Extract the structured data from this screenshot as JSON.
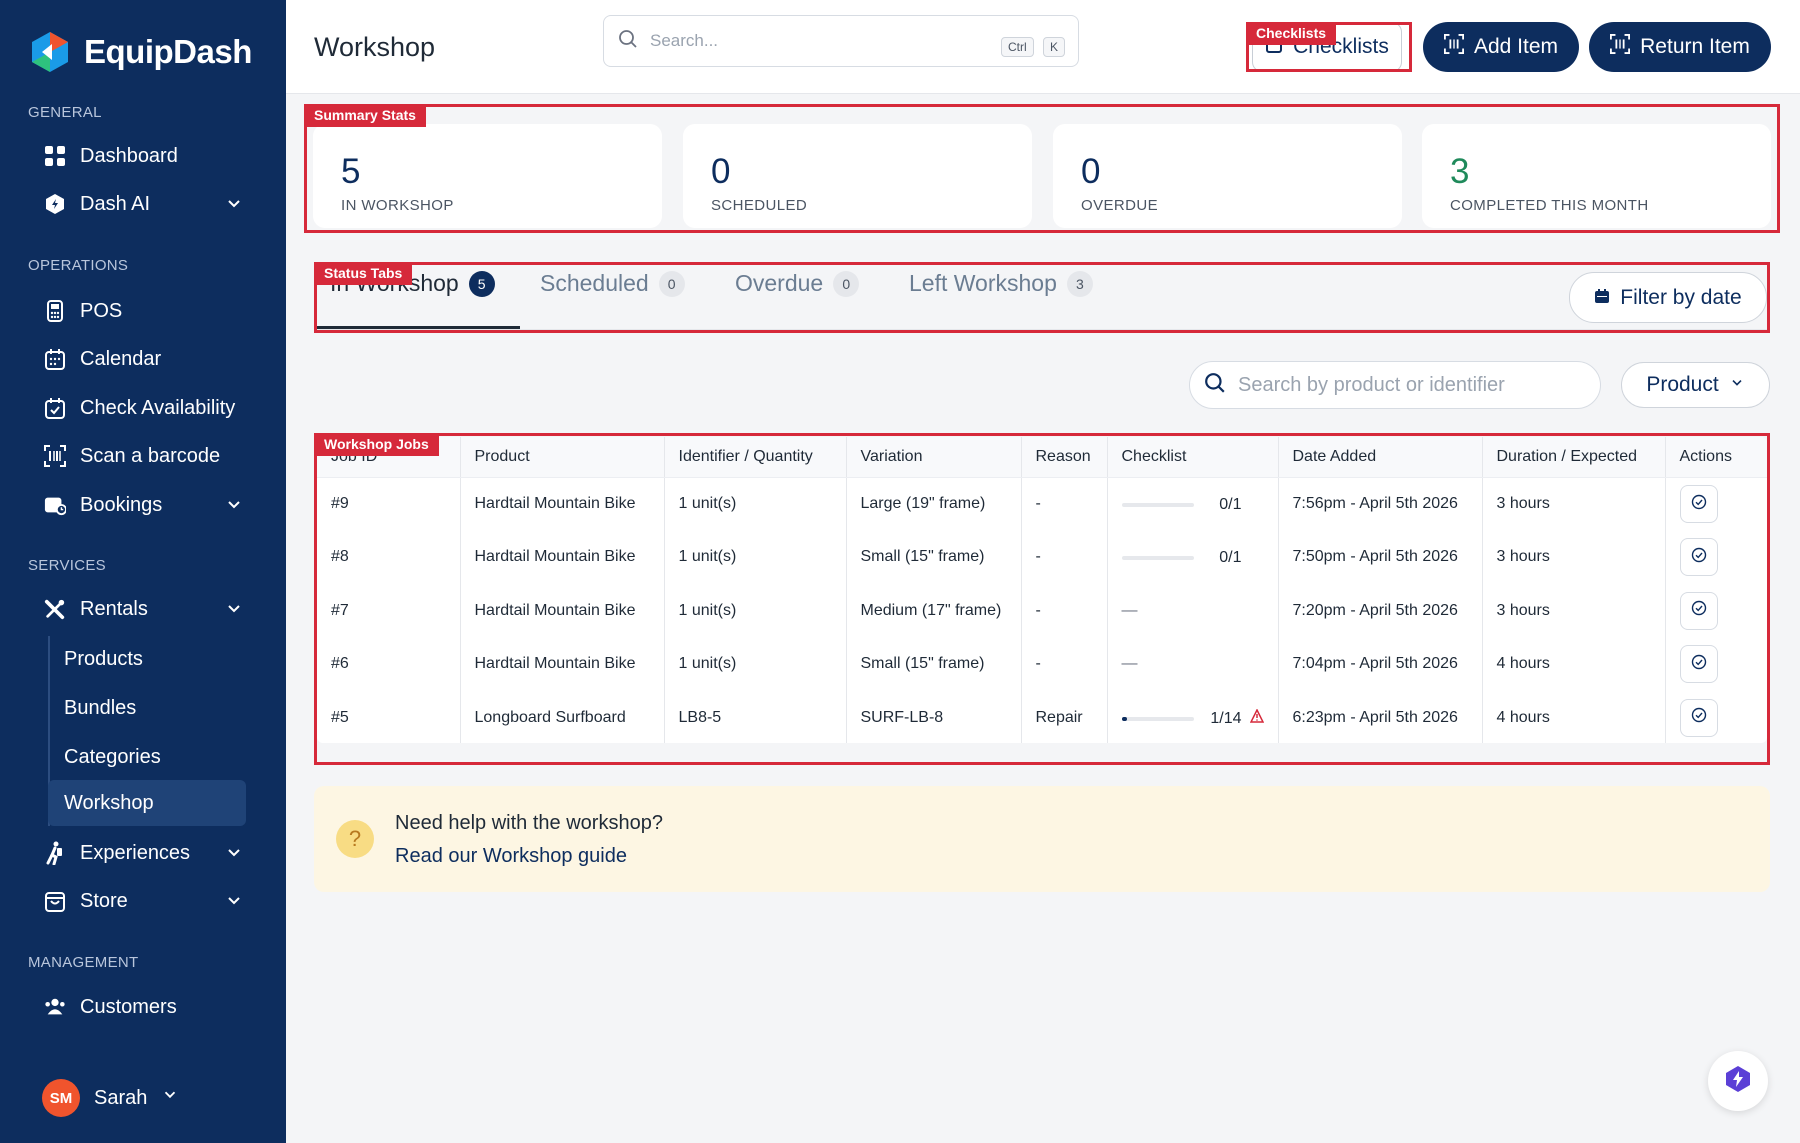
{
  "app": {
    "name": "EquipDash"
  },
  "sidebar": {
    "sections": {
      "general": "GENERAL",
      "operations": "OPERATIONS",
      "services": "SERVICES",
      "management": "MANAGEMENT"
    },
    "general_items": [
      {
        "label": "Dashboard",
        "icon": "grid-icon"
      },
      {
        "label": "Dash AI",
        "icon": "hexagon-ai-icon"
      }
    ],
    "operations_items": [
      {
        "label": "POS",
        "icon": "pos-terminal-icon"
      },
      {
        "label": "Calendar",
        "icon": "calendar-icon"
      },
      {
        "label": "Check Availability",
        "icon": "calendar-check-icon"
      },
      {
        "label": "Scan a barcode",
        "icon": "barcode-scan-icon"
      },
      {
        "label": "Bookings",
        "icon": "bookings-icon"
      }
    ],
    "services_items": [
      {
        "label": "Rentals",
        "icon": "tools-icon"
      },
      {
        "label": "Experiences",
        "icon": "person-hiking-icon"
      },
      {
        "label": "Store",
        "icon": "shopping-bag-icon"
      }
    ],
    "rentals_sub": [
      "Products",
      "Bundles",
      "Categories",
      "Workshop"
    ],
    "management_items": [
      {
        "label": "Customers",
        "icon": "users-icon"
      }
    ],
    "user": {
      "initials": "SM",
      "name": "Sarah"
    }
  },
  "header": {
    "title": "Workshop",
    "search_placeholder": "Search...",
    "kbd_ctrl": "Ctrl",
    "kbd_k": "K",
    "checklists_label": "Checklists",
    "add_item_label": "Add Item",
    "return_item_label": "Return Item"
  },
  "annotations": {
    "checklists": "Checklists",
    "summary": "Summary Stats",
    "tabs": "Status Tabs",
    "jobs": "Workshop Jobs"
  },
  "stats": [
    {
      "value": "5",
      "label": "IN WORKSHOP",
      "color": "#0d2d5e"
    },
    {
      "value": "0",
      "label": "SCHEDULED",
      "color": "#0d2d5e"
    },
    {
      "value": "0",
      "label": "OVERDUE",
      "color": "#0d2d5e"
    },
    {
      "value": "3",
      "label": "COMPLETED THIS MONTH",
      "color": "#1f8a5b"
    }
  ],
  "tabs": [
    {
      "label": "In Workshop",
      "count": "5"
    },
    {
      "label": "Scheduled",
      "count": "0"
    },
    {
      "label": "Overdue",
      "count": "0"
    },
    {
      "label": "Left Workshop",
      "count": "3"
    }
  ],
  "filter_by_date_label": "Filter by date",
  "table_search_placeholder": "Search by product or identifier",
  "product_filter_label": "Product",
  "table": {
    "headers": [
      "Job ID",
      "Product",
      "Identifier / Quantity",
      "Variation",
      "Reason",
      "Checklist",
      "Date Added",
      "Duration / Expected",
      "Actions"
    ],
    "rows": [
      {
        "id": "#9",
        "product": "Hardtail Mountain Bike",
        "identifier": "1 unit(s)",
        "variation": "Large (19\" frame)",
        "reason": "-",
        "checklist": "0/1",
        "progress": 0,
        "warn": false,
        "date": "7:56pm - April 5th 2026",
        "duration": "3 hours"
      },
      {
        "id": "#8",
        "product": "Hardtail Mountain Bike",
        "identifier": "1 unit(s)",
        "variation": "Small (15\" frame)",
        "reason": "-",
        "checklist": "0/1",
        "progress": 0,
        "warn": false,
        "date": "7:50pm - April 5th 2026",
        "duration": "3 hours"
      },
      {
        "id": "#7",
        "product": "Hardtail Mountain Bike",
        "identifier": "1 unit(s)",
        "variation": "Medium (17\" frame)",
        "reason": "-",
        "checklist": "—",
        "progress": null,
        "warn": false,
        "date": "7:20pm - April 5th 2026",
        "duration": "3 hours"
      },
      {
        "id": "#6",
        "product": "Hardtail Mountain Bike",
        "identifier": "1 unit(s)",
        "variation": "Small (15\" frame)",
        "reason": "-",
        "checklist": "—",
        "progress": null,
        "warn": false,
        "date": "7:04pm - April 5th 2026",
        "duration": "4 hours"
      },
      {
        "id": "#5",
        "product": "Longboard Surfboard",
        "identifier": "LB8-5",
        "variation": "SURF-LB-8",
        "reason": "Repair",
        "checklist": "1/14",
        "progress": 0.0714,
        "warn": true,
        "date": "6:23pm - April 5th 2026",
        "duration": "4 hours"
      }
    ]
  },
  "help": {
    "question": "Need help with the workshop?",
    "link": "Read our Workshop guide"
  },
  "colors": {
    "sidebar": "#0d2d5e",
    "accent": "#0d2d5e",
    "annotation": "#d6293a",
    "success": "#1f8a5b"
  }
}
